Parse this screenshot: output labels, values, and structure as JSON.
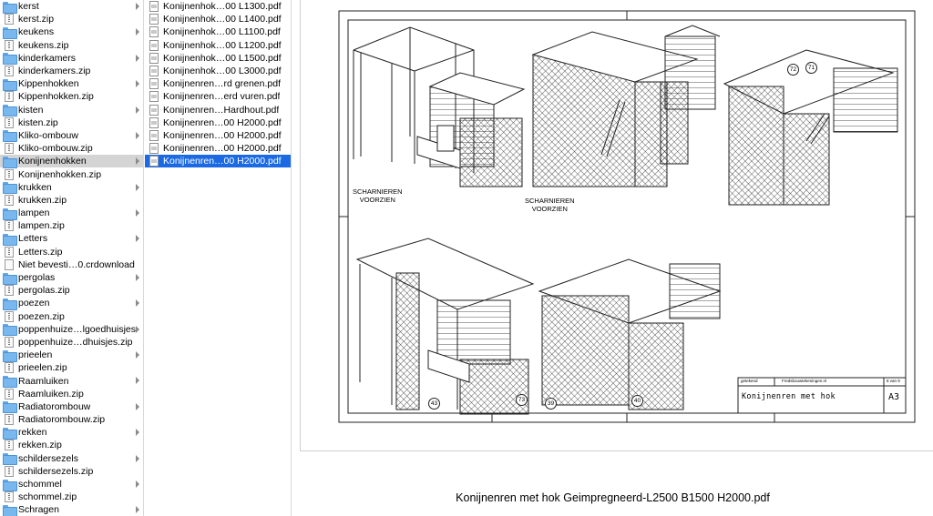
{
  "column1": {
    "items": [
      {
        "label": "kerst",
        "type": "folder",
        "arrow": true
      },
      {
        "label": "kerst.zip",
        "type": "zip",
        "arrow": false
      },
      {
        "label": "keukens",
        "type": "folder",
        "arrow": true
      },
      {
        "label": "keukens.zip",
        "type": "zip",
        "arrow": false
      },
      {
        "label": "kinderkamers",
        "type": "folder",
        "arrow": true
      },
      {
        "label": "kinderkamers.zip",
        "type": "zip",
        "arrow": false
      },
      {
        "label": "Kippenhokken",
        "type": "folder",
        "arrow": true
      },
      {
        "label": "Kippenhokken.zip",
        "type": "zip",
        "arrow": false
      },
      {
        "label": "kisten",
        "type": "folder",
        "arrow": true
      },
      {
        "label": "kisten.zip",
        "type": "zip",
        "arrow": false
      },
      {
        "label": "Kliko-ombouw",
        "type": "folder",
        "arrow": true
      },
      {
        "label": "Kliko-ombouw.zip",
        "type": "zip",
        "arrow": false
      },
      {
        "label": "Konijnenhokken",
        "type": "folder",
        "arrow": true,
        "selected": true
      },
      {
        "label": "Konijnenhokken.zip",
        "type": "zip",
        "arrow": false
      },
      {
        "label": "krukken",
        "type": "folder",
        "arrow": true
      },
      {
        "label": "krukken.zip",
        "type": "zip",
        "arrow": false
      },
      {
        "label": "lampen",
        "type": "folder",
        "arrow": true
      },
      {
        "label": "lampen.zip",
        "type": "zip",
        "arrow": false
      },
      {
        "label": "Letters",
        "type": "folder",
        "arrow": true
      },
      {
        "label": "Letters.zip",
        "type": "zip",
        "arrow": false
      },
      {
        "label": "Niet bevesti…0.crdownload",
        "type": "doc",
        "arrow": false
      },
      {
        "label": "pergolas",
        "type": "folder",
        "arrow": true
      },
      {
        "label": "pergolas.zip",
        "type": "zip",
        "arrow": false
      },
      {
        "label": "poezen",
        "type": "folder",
        "arrow": true
      },
      {
        "label": "poezen.zip",
        "type": "zip",
        "arrow": false
      },
      {
        "label": "poppenhuize…lgoedhuisjes",
        "type": "folder",
        "arrow": true
      },
      {
        "label": "poppenhuize…dhuisjes.zip",
        "type": "zip",
        "arrow": false
      },
      {
        "label": "prieelen",
        "type": "folder",
        "arrow": true
      },
      {
        "label": "prieelen.zip",
        "type": "zip",
        "arrow": false
      },
      {
        "label": "Raamluiken",
        "type": "folder",
        "arrow": true
      },
      {
        "label": "Raamluiken.zip",
        "type": "zip",
        "arrow": false
      },
      {
        "label": "Radiatorombouw",
        "type": "folder",
        "arrow": true
      },
      {
        "label": "Radiatorombouw.zip",
        "type": "zip",
        "arrow": false
      },
      {
        "label": "rekken",
        "type": "folder",
        "arrow": true
      },
      {
        "label": "rekken.zip",
        "type": "zip",
        "arrow": false
      },
      {
        "label": "schildersezels",
        "type": "folder",
        "arrow": true
      },
      {
        "label": "schildersezels.zip",
        "type": "zip",
        "arrow": false
      },
      {
        "label": "schommel",
        "type": "folder",
        "arrow": true
      },
      {
        "label": "schommel.zip",
        "type": "zip",
        "arrow": false
      },
      {
        "label": "Schragen",
        "type": "folder",
        "arrow": true
      }
    ]
  },
  "column2": {
    "items": [
      {
        "label": "Konijnenhok…00 L1300.pdf"
      },
      {
        "label": "Konijnenhok…00 L1400.pdf"
      },
      {
        "label": "Konijnenhok…00 L1100.pdf"
      },
      {
        "label": "Konijnenhok…00 L1200.pdf"
      },
      {
        "label": "Konijnenhok…00 L1500.pdf"
      },
      {
        "label": "Konijnenhok…00 L3000.pdf"
      },
      {
        "label": "Konijnenren…rd grenen.pdf"
      },
      {
        "label": "Konijnenren…erd vuren.pdf"
      },
      {
        "label": "Konijnenren…Hardhout.pdf"
      },
      {
        "label": "Konijnenren…00 H2000.pdf"
      },
      {
        "label": "Konijnenren…00 H2000.pdf"
      },
      {
        "label": "Konijnenren…00 H2000.pdf"
      },
      {
        "label": "Konijnenren…00 H2000.pdf",
        "selected": true
      }
    ]
  },
  "preview": {
    "file_name": "Konijnenren met hok Geimpregneerd-L2500 B1500 H2000.pdf",
    "drawing": {
      "annotation_left": [
        "SCHARNIEREN",
        "VOORZIEN"
      ],
      "annotation_mid": [
        "SCHARNIEREN",
        "VOORZIEN"
      ],
      "bubbles_top": [
        "72",
        "71"
      ],
      "bubbles_bottom": [
        "43",
        "73",
        "39",
        "40"
      ],
      "title_block": {
        "drawn_label": "getekend",
        "site": "Fredsbouwtekeningen.nl",
        "sheet": "8 van 9",
        "title": "Konijnenren met hok",
        "format": "A3"
      }
    }
  }
}
